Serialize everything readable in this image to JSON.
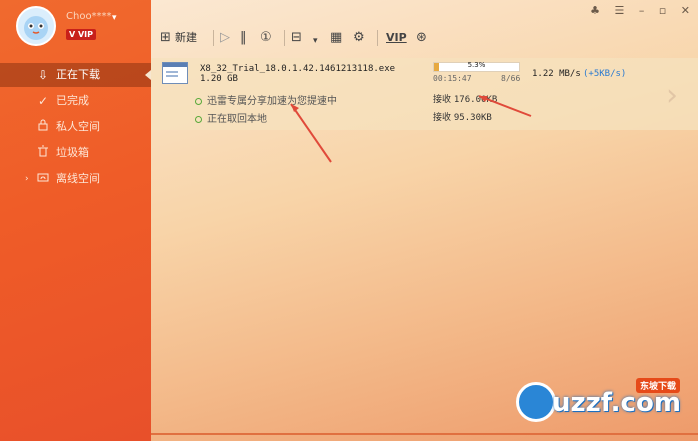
{
  "user": {
    "name": "Choo****",
    "vip_label": "VIP"
  },
  "sidebar": {
    "items": [
      {
        "label": "正在下载",
        "icon": "download-icon"
      },
      {
        "label": "已完成",
        "icon": "check-circle-icon"
      },
      {
        "label": "私人空间",
        "icon": "lock-icon"
      },
      {
        "label": "垃圾箱",
        "icon": "trash-icon"
      },
      {
        "label": "离线空间",
        "icon": "cloud-folder-icon"
      }
    ]
  },
  "toolbar": {
    "new_label": "新建",
    "vip_label": "VIP"
  },
  "task": {
    "filename": "X8_32_Trial_18.0.1.42.1461213118.exe",
    "size": "1.20 GB",
    "progress_text": "5.3%",
    "progress": 0.053,
    "time_left": "00:15:47",
    "segments": "8/66",
    "speed": "1.22  MB/s",
    "speed_extra": "(+5KB/s)",
    "status1": "迅雷专属分享加速为您提速中",
    "status2": "正在取回本地",
    "recv1_label": "接收",
    "recv1_value": "176.00KB",
    "recv2_label": "接收",
    "recv2_value": "95.30KB"
  },
  "watermark": {
    "text": "uzzf.com",
    "badge": "东坡下载"
  },
  "colors": {
    "accent": "#ef5c28",
    "progress": "#e7a940",
    "link": "#2a7ad0"
  }
}
